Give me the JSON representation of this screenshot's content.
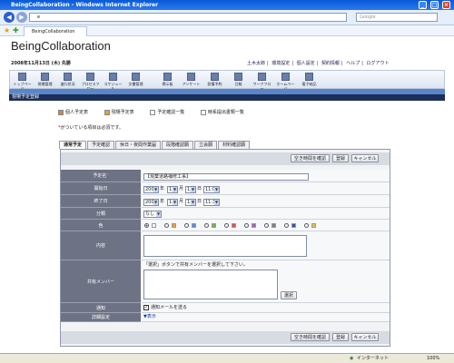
{
  "browser": {
    "title": "BeingCollaboration - Windows Internet Explorer",
    "url": "e",
    "search_placeholder": "Google",
    "tab_label": "BeingCollaboration",
    "status_zone": "インターネット",
    "zoom": "100%"
  },
  "app": {
    "name": "BeingCollaboration",
    "date": "2008年11月13日 (木) 先勝",
    "header_links": [
      "土木太郎",
      "環境設定",
      "個人設定",
      "契約情報",
      "ヘルプ",
      "ログアウト"
    ],
    "toolbar": [
      "トップページ",
      "現場管理",
      "進行状況",
      "プロセスフロー",
      "スケジュール",
      "文書管理",
      "掲示板",
      "アンケート",
      "設備予約",
      "日報",
      "ワークフロー",
      "ホームページ",
      "電子納品"
    ]
  },
  "page": {
    "section_title": "現場予定登録",
    "legend": [
      "個人予定表",
      "現場予定表",
      "予定確認一覧",
      "時系提出書類一覧"
    ],
    "required_note": "がついている項目は必須です。",
    "required_mark": "*",
    "tabs": [
      "通常予定",
      "予定確認",
      "休日・夜間作業届",
      "段階確認願",
      "立会願",
      "材料確認願"
    ],
    "buttons": {
      "check_time": "空き時間を確認",
      "register": "登録",
      "cancel": "キャンセル",
      "select": "選択"
    },
    "fields": {
      "title_label": "予定名",
      "title_value": "【現業道路補修工事】",
      "required_mark": "*",
      "start_label": "開始日",
      "start": {
        "year": "2008",
        "year_unit": "年",
        "month": "11",
        "month_unit": "月",
        "day": "13",
        "day_unit": "日",
        "time": "11:00"
      },
      "end_label": "終了日",
      "end": {
        "year": "2008",
        "year_unit": "年",
        "month": "11",
        "month_unit": "月",
        "day": "13",
        "day_unit": "日",
        "time": "11:30"
      },
      "category_label": "分類",
      "category_value": "なし",
      "color_label": "色",
      "content_label": "内容",
      "members_label": "共有メンバー",
      "members_note": "「選択」ボタンで共有メンバーを選択して下さい。",
      "notify_label": "通知",
      "notify_text": "通知メールを送る",
      "detail_label": "詳細設定",
      "detail_toggle": "▼表示"
    },
    "colors": [
      "#ffffff",
      "#f0a030",
      "#4a90e0",
      "#70b050",
      "#e05050",
      "#a060c0",
      "#808080",
      "#3050a0",
      "#e0c040"
    ]
  }
}
